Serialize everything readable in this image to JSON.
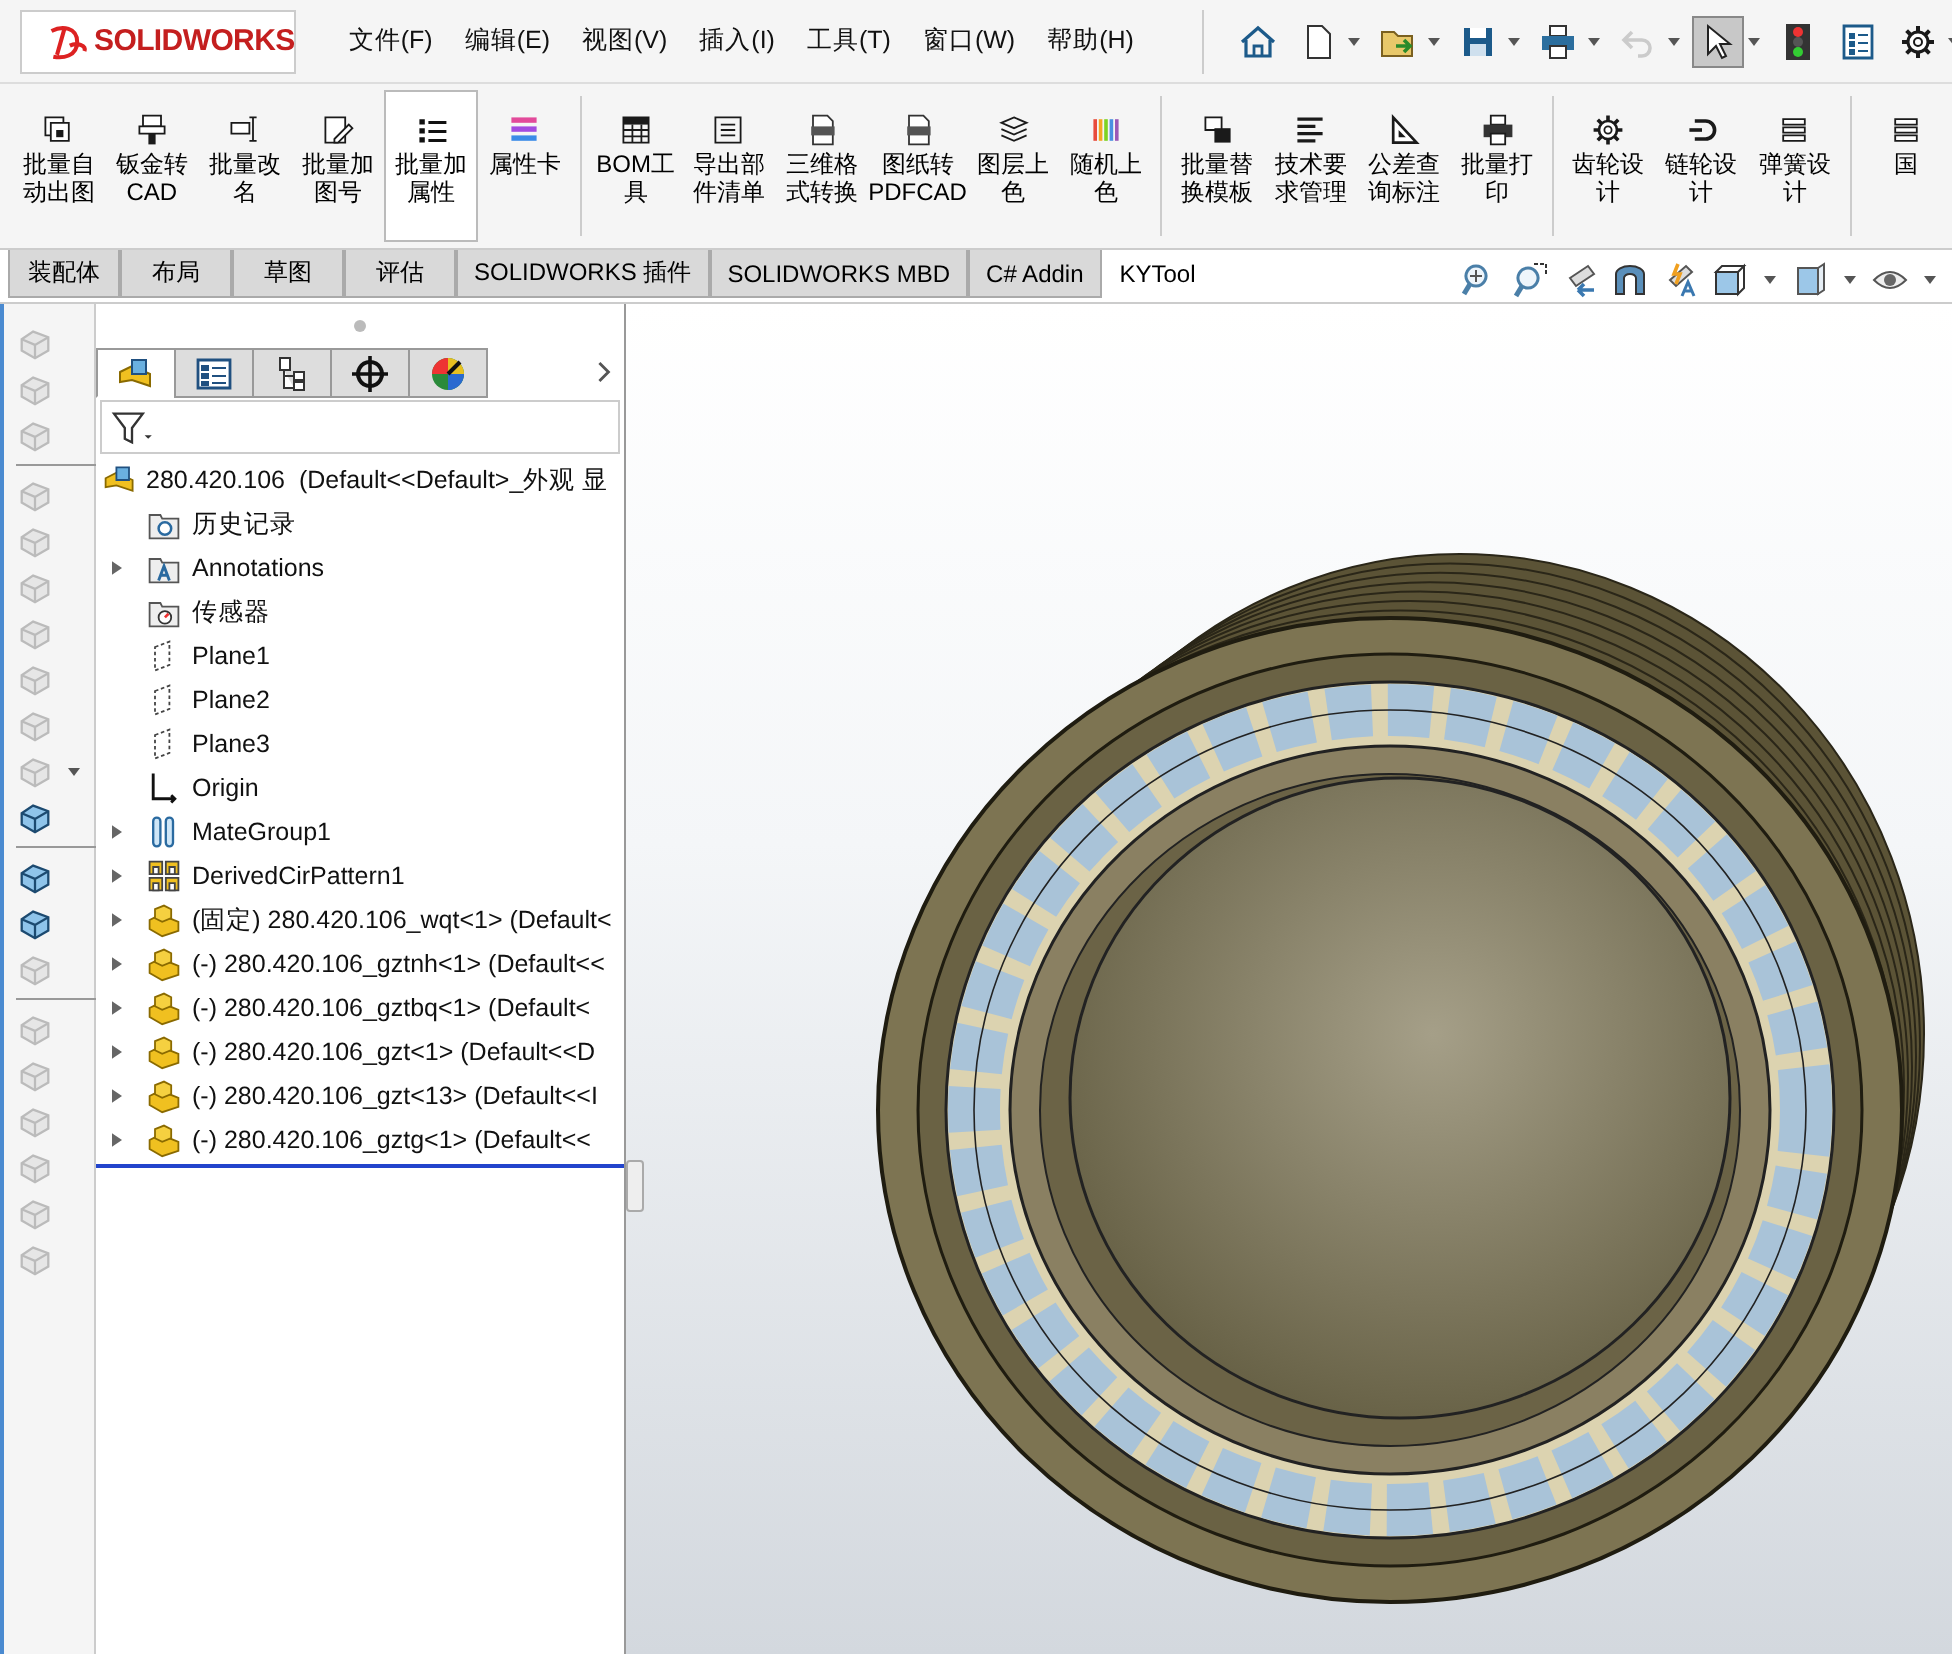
{
  "logo": {
    "text": "SOLIDWORKS"
  },
  "menu": [
    "文件(F)",
    "编辑(E)",
    "视图(V)",
    "插入(I)",
    "工具(T)",
    "窗口(W)",
    "帮助(H)"
  ],
  "quick_tools": [
    {
      "kind": "home",
      "dropdown": false,
      "selected": false,
      "disabled": false
    },
    {
      "kind": "newdoc",
      "dropdown": true,
      "selected": false,
      "disabled": false
    },
    {
      "kind": "open",
      "dropdown": true,
      "selected": false,
      "disabled": false
    },
    {
      "kind": "save",
      "dropdown": true,
      "selected": false,
      "disabled": false
    },
    {
      "kind": "print",
      "dropdown": true,
      "selected": false,
      "disabled": false
    },
    {
      "kind": "undo",
      "dropdown": true,
      "selected": false,
      "disabled": true
    },
    {
      "kind": "select",
      "dropdown": true,
      "selected": true,
      "disabled": false
    },
    {
      "kind": "traffic",
      "dropdown": false,
      "selected": false,
      "disabled": false
    },
    {
      "kind": "props",
      "dropdown": false,
      "selected": false,
      "disabled": false
    },
    {
      "kind": "gear",
      "dropdown": true,
      "selected": false,
      "disabled": false
    }
  ],
  "ribbon": {
    "groups": [
      [
        {
          "label": "批量自动出图",
          "kind": "stack",
          "selected": false
        },
        {
          "label": "钣金转\nCAD",
          "kind": "sheet",
          "selected": false
        },
        {
          "label": "批量改名",
          "kind": "rename",
          "selected": false
        },
        {
          "label": "批量加图号",
          "kind": "edit",
          "selected": false
        },
        {
          "label": "批量加属性",
          "kind": "bullets",
          "selected": true
        },
        {
          "label": "属性卡",
          "kind": "colorbars",
          "selected": false
        }
      ],
      [
        {
          "label": "BOM工具",
          "kind": "table",
          "selected": false
        },
        {
          "label": "导出部件清单",
          "kind": "form",
          "selected": false
        },
        {
          "label": "三维格式转换",
          "kind": "pdf",
          "selected": false
        },
        {
          "label": "图纸转\nPDFCAD",
          "kind": "pdf",
          "selected": false
        },
        {
          "label": "图层上色",
          "kind": "layers",
          "selected": false
        },
        {
          "label": "随机上色",
          "kind": "pencils",
          "selected": false
        }
      ],
      [
        {
          "label": "批量替换模板",
          "kind": "replace",
          "selected": false
        },
        {
          "label": "技术要求管理",
          "kind": "lines",
          "selected": false
        },
        {
          "label": "公差查询标注",
          "kind": "setsquare",
          "selected": false
        },
        {
          "label": "批量打印",
          "kind": "printer",
          "selected": false
        }
      ],
      [
        {
          "label": "齿轮设计",
          "kind": "gear",
          "selected": false
        },
        {
          "label": "链轮设计",
          "kind": "chain",
          "selected": false
        },
        {
          "label": "弹簧设计",
          "kind": "spring",
          "selected": false
        }
      ],
      [
        {
          "label": "国",
          "kind": "spring",
          "selected": false
        }
      ]
    ]
  },
  "command_tabs": [
    {
      "label": "装配体",
      "selected": false
    },
    {
      "label": "布局",
      "selected": false
    },
    {
      "label": "草图",
      "selected": false
    },
    {
      "label": "评估",
      "selected": false
    },
    {
      "label": "SOLIDWORKS 插件",
      "selected": false
    },
    {
      "label": "SOLIDWORKS MBD",
      "selected": false
    },
    {
      "label": "C# Addin",
      "selected": false
    },
    {
      "label": "KYTool",
      "selected": true
    }
  ],
  "view_tools": [
    {
      "kind": "zoomfit",
      "dropdown": false
    },
    {
      "kind": "zoomarea",
      "dropdown": false
    },
    {
      "kind": "prevview",
      "dropdown": false
    },
    {
      "kind": "section",
      "dropdown": false
    },
    {
      "kind": "annot",
      "dropdown": false
    },
    {
      "kind": "orient",
      "dropdown": true
    },
    {
      "kind": "display",
      "dropdown": true
    },
    {
      "kind": "hideshow",
      "dropdown": true
    }
  ],
  "left_strip": [
    [
      {
        "disabled": true,
        "dropdown": false
      },
      {
        "disabled": true,
        "dropdown": false
      },
      {
        "disabled": true,
        "dropdown": false
      }
    ],
    [
      {
        "disabled": true,
        "dropdown": false
      },
      {
        "disabled": true,
        "dropdown": false
      },
      {
        "disabled": true,
        "dropdown": false
      },
      {
        "disabled": true,
        "dropdown": false
      },
      {
        "disabled": true,
        "dropdown": false
      },
      {
        "disabled": true,
        "dropdown": false
      },
      {
        "disabled": true,
        "dropdown": true
      },
      {
        "disabled": false,
        "dropdown": false
      }
    ],
    [
      {
        "disabled": false,
        "dropdown": false
      },
      {
        "disabled": false,
        "dropdown": false
      },
      {
        "disabled": true,
        "dropdown": false
      }
    ],
    [
      {
        "disabled": true,
        "dropdown": false
      },
      {
        "disabled": true,
        "dropdown": false
      },
      {
        "disabled": true,
        "dropdown": false
      },
      {
        "disabled": true,
        "dropdown": false
      },
      {
        "disabled": true,
        "dropdown": false
      },
      {
        "disabled": true,
        "dropdown": false
      }
    ]
  ],
  "tree_tabs": [
    {
      "kind": "feature",
      "selected": true
    },
    {
      "kind": "property",
      "selected": false
    },
    {
      "kind": "config",
      "selected": false
    },
    {
      "kind": "dimx",
      "selected": false
    },
    {
      "kind": "display",
      "selected": false
    }
  ],
  "tree": {
    "root": "280.420.106  (Default<<Default>_外观 显",
    "items": [
      {
        "label": "历史记录",
        "kind": "history",
        "expandable": false
      },
      {
        "label": "Annotations",
        "kind": "annot",
        "expandable": true
      },
      {
        "label": "传感器",
        "kind": "sensor",
        "expandable": false
      },
      {
        "label": "Plane1",
        "kind": "plane",
        "expandable": false
      },
      {
        "label": "Plane2",
        "kind": "plane",
        "expandable": false
      },
      {
        "label": "Plane3",
        "kind": "plane",
        "expandable": false
      },
      {
        "label": "Origin",
        "kind": "origin",
        "expandable": false
      },
      {
        "label": "MateGroup1",
        "kind": "mates",
        "expandable": true
      },
      {
        "label": "DerivedCirPattern1",
        "kind": "pattern",
        "expandable": true
      },
      {
        "label": "(固定) 280.420.106_wqt<1> (Default<",
        "kind": "part",
        "expandable": true
      },
      {
        "label": "(-) 280.420.106_gztnh<1> (Default<<",
        "kind": "part",
        "expandable": true
      },
      {
        "label": "(-) 280.420.106_gztbq<1> (Default<",
        "kind": "part",
        "expandable": true
      },
      {
        "label": "(-) 280.420.106_gzt<1> (Default<<D",
        "kind": "part",
        "expandable": true
      },
      {
        "label": "(-) 280.420.106_gzt<13> (Default<<I",
        "kind": "part",
        "expandable": true
      },
      {
        "label": "(-) 280.420.106_gztg<1> (Default<<",
        "kind": "part",
        "expandable": true
      }
    ]
  }
}
